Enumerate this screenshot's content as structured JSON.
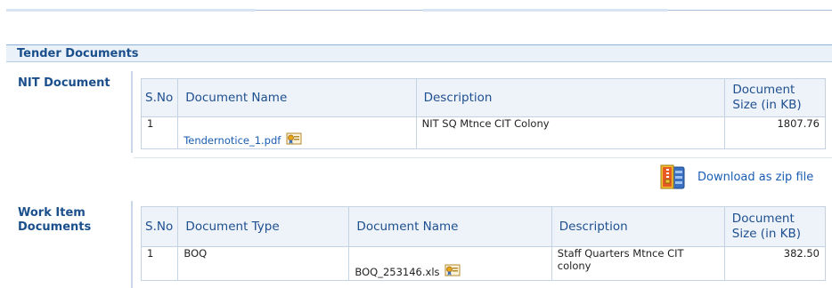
{
  "section": {
    "title": "Tender Documents"
  },
  "nit": {
    "label": "NIT Document",
    "columns": [
      "S.No",
      "Document Name",
      "Description",
      "Document Size (in KB)"
    ],
    "rows": [
      {
        "sno": "1",
        "name": "Tendernotice_1.pdf",
        "description": "NIT SQ Mtnce CIT Colony",
        "size": "1807.76"
      }
    ]
  },
  "download": {
    "label": "Download as zip file",
    "icon": "zip-archive-icon"
  },
  "work": {
    "label_line1": "Work Item",
    "label_line2": "Documents",
    "columns": [
      "S.No",
      "Document Type",
      "Document Name",
      "Description",
      "Document Size (in KB)"
    ],
    "rows": [
      {
        "sno": "1",
        "type": "BOQ",
        "name": "BOQ_253146.xls",
        "description": "Staff Quarters Mtnce CIT colony",
        "size": "382.50"
      }
    ]
  },
  "colors": {
    "header_text": "#1a4f8c",
    "link": "#1a5db3",
    "header_bg": "#eaf1f9",
    "border": "#c4d2e4"
  }
}
